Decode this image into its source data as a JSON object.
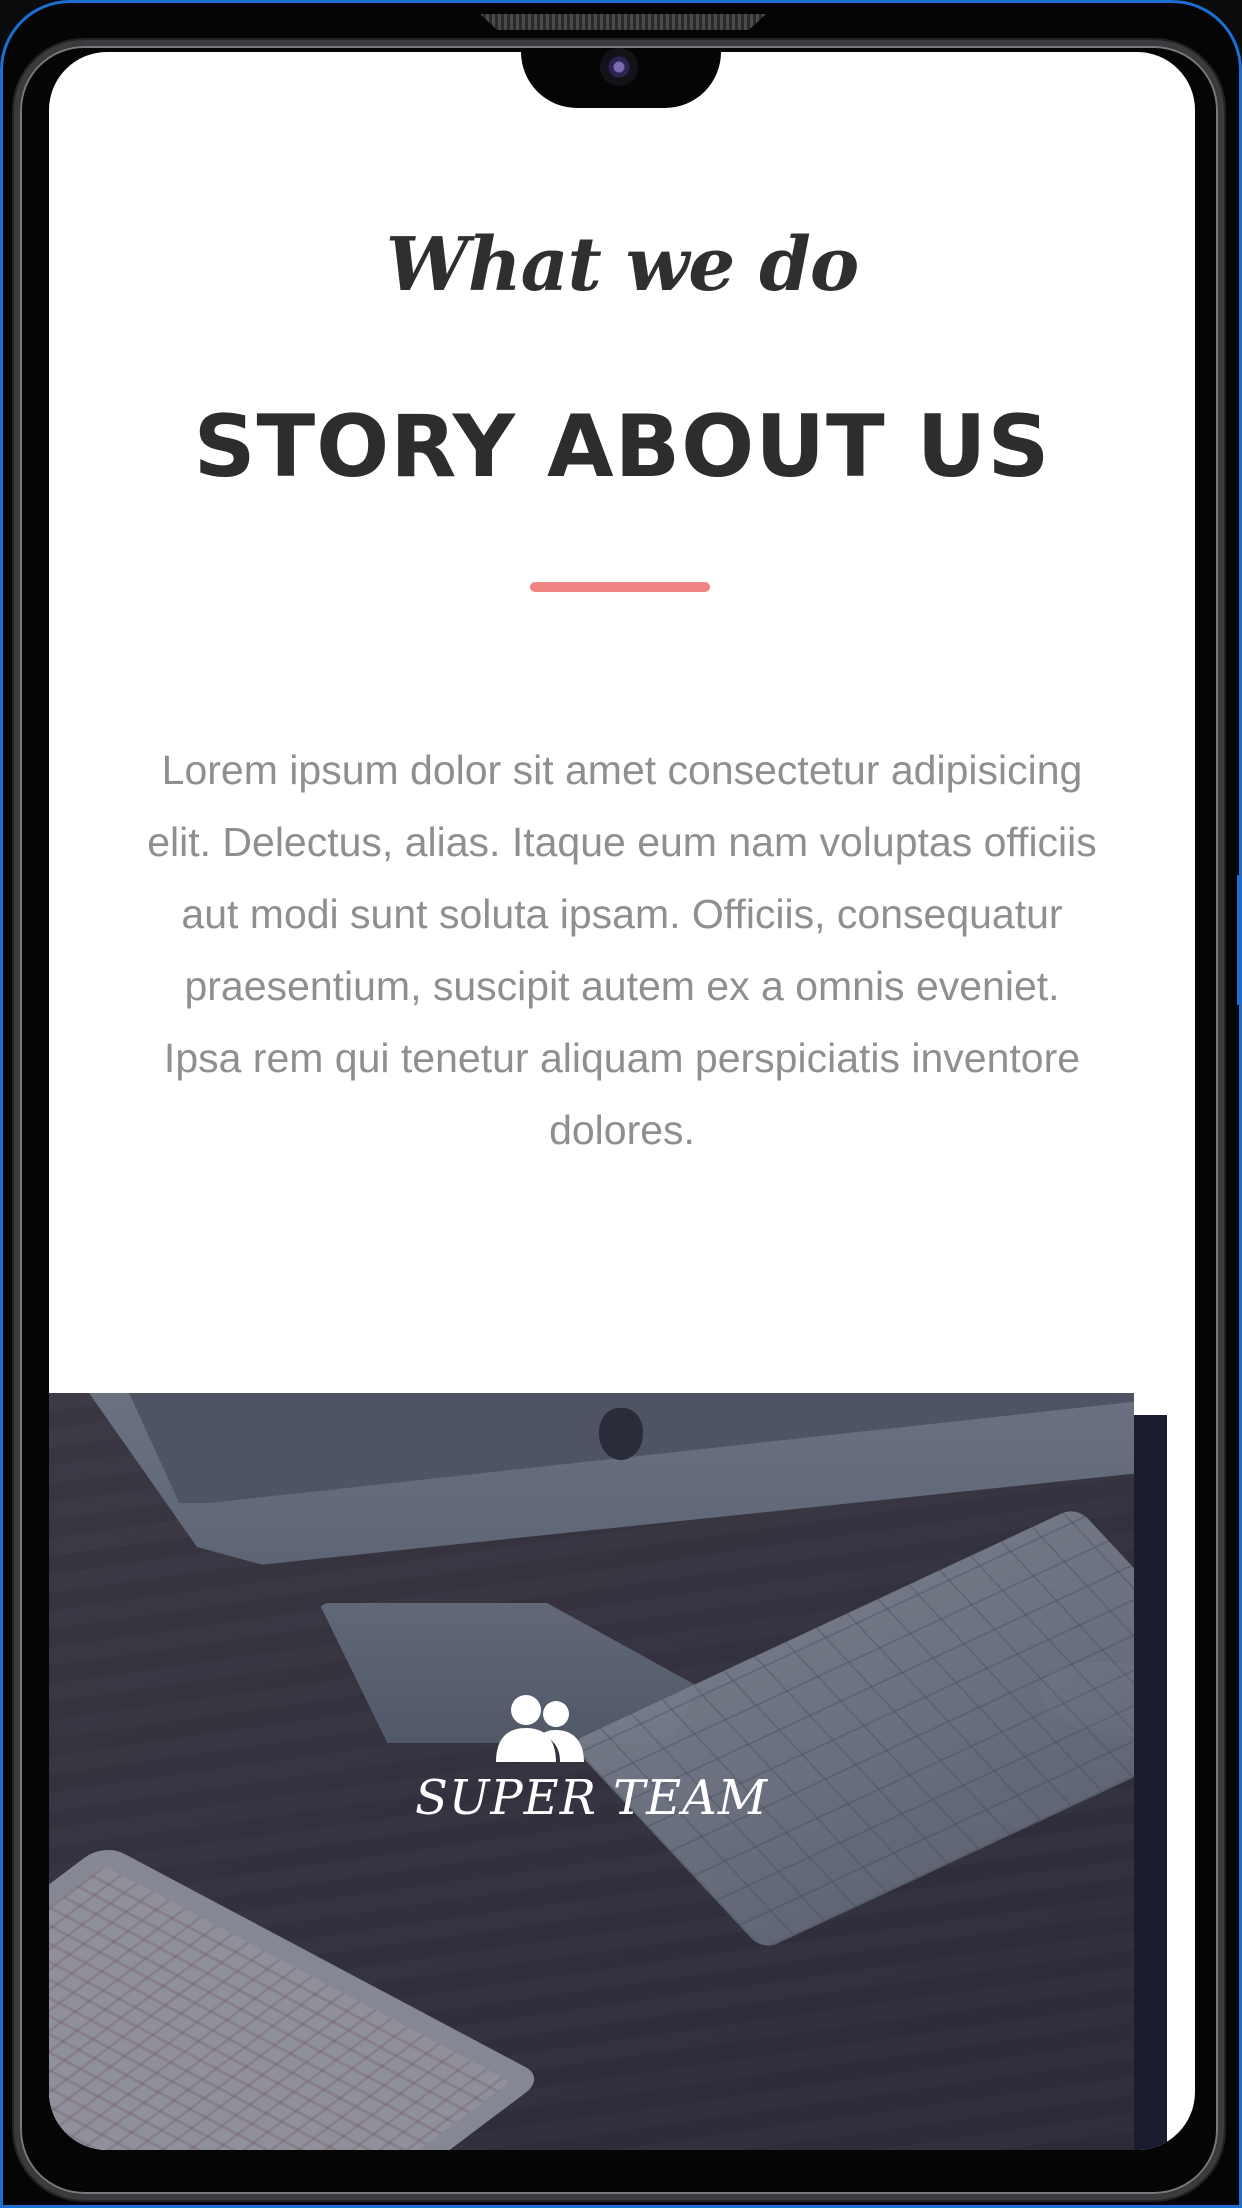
{
  "section": {
    "script_title": "What we do",
    "main_title": "STORY ABOUT US",
    "body": "Lorem ipsum dolor sit amet consectetur adipisicing elit. Delectus, alias. Itaque eum nam voluptas officiis aut modi sunt soluta ipsam. Officiis, consequatur praesentium, suscipit autem ex a omnis eveniet. Ipsa rem qui tenetur aliquam perspiciatis inventore dolores."
  },
  "feature": {
    "label": "SUPER TEAM",
    "icon": "users-icon"
  },
  "colors": {
    "accent": "#f08383",
    "heading": "#2d2d2d",
    "body_text": "#8f8f8f",
    "overlay": "#282c3e",
    "frame_edge": "#1a6fd1"
  }
}
